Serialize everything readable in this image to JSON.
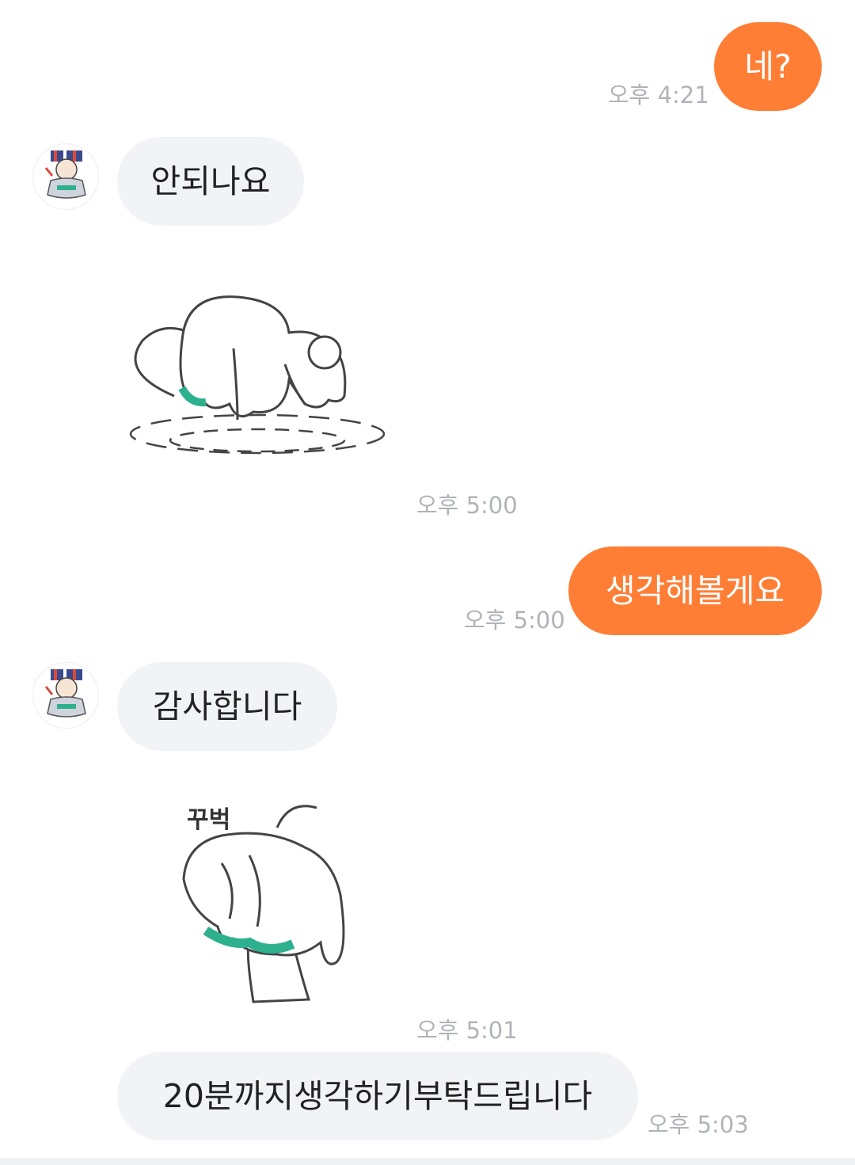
{
  "messages": [
    {
      "from": "me",
      "text": "네?",
      "time": "오후 4:21"
    },
    {
      "from": "them",
      "text": "안되나요"
    },
    {
      "from": "them",
      "sticker": "bowing-bear-sticker",
      "time": "오후 5:00"
    },
    {
      "from": "me",
      "text": "생각해볼게요",
      "time": "오후 5:00"
    },
    {
      "from": "them",
      "text": "감사합니다"
    },
    {
      "from": "them",
      "sticker": "bow-sticker",
      "sticker_text": "꾸벅",
      "time": "오후 5:01"
    },
    {
      "from": "them",
      "text": "20분까지생각하기부탁드립니다",
      "time": "오후 5:03"
    }
  ],
  "colors": {
    "me_bubble": "#ff7e36",
    "them_bubble": "#f2f3f6",
    "time": "#b0b3b8",
    "sticker_accent": "#2db08d"
  }
}
